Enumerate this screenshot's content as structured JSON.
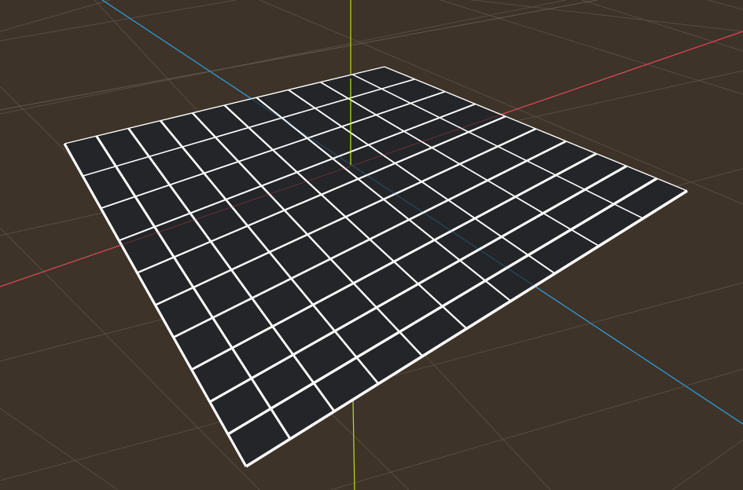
{
  "viewport": {
    "background_color": "#3e3328",
    "floor_grid_color": "#5c5248",
    "floor_grid_major_color": "#6f665c"
  },
  "axes": {
    "x_axis_color": "#e0485e",
    "y_axis_color": "#b4e01e",
    "z_axis_color": "#2ea0e6"
  },
  "plane": {
    "fill_color": "#232528",
    "grid_line_color": "#ffffff",
    "divisions": 10
  }
}
